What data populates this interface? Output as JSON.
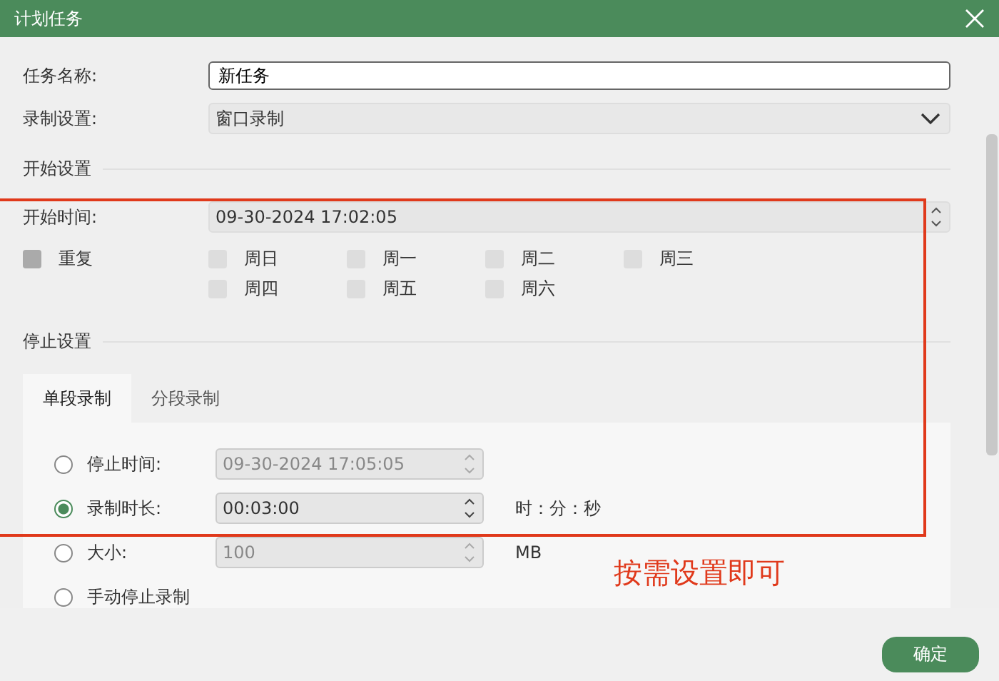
{
  "window": {
    "title": "计划任务"
  },
  "task_name": {
    "label": "任务名称:",
    "value": "新任务"
  },
  "record_setting": {
    "label": "录制设置:",
    "value": "窗口录制"
  },
  "start_section": {
    "heading": "开始设置",
    "start_time": {
      "label": "开始时间:",
      "value": "09-30-2024 17:02:05"
    },
    "repeat": {
      "label": "重复",
      "checked": false
    },
    "days": [
      {
        "label": "周日",
        "checked": false
      },
      {
        "label": "周一",
        "checked": false
      },
      {
        "label": "周二",
        "checked": false
      },
      {
        "label": "周三",
        "checked": false
      },
      {
        "label": "周四",
        "checked": false
      },
      {
        "label": "周五",
        "checked": false
      },
      {
        "label": "周六",
        "checked": false
      }
    ]
  },
  "stop_section": {
    "heading": "停止设置",
    "tabs": [
      {
        "label": "单段录制",
        "selected": true
      },
      {
        "label": "分段录制",
        "selected": false
      }
    ],
    "options": [
      {
        "kind": "spin",
        "label": "停止时间:",
        "value": "09-30-2024 17:05:05",
        "selected": false
      },
      {
        "kind": "spin",
        "label": "录制时长:",
        "value": "00:03:00",
        "unit": "时：分：秒",
        "selected": true
      },
      {
        "kind": "spin",
        "label": "大小:",
        "value": "100",
        "unit": "MB",
        "selected": false
      },
      {
        "kind": "plain",
        "label": "手动停止录制",
        "selected": false
      }
    ]
  },
  "annotation": {
    "text": "按需设置即可"
  },
  "footer": {
    "buttons": [
      "确定"
    ]
  }
}
